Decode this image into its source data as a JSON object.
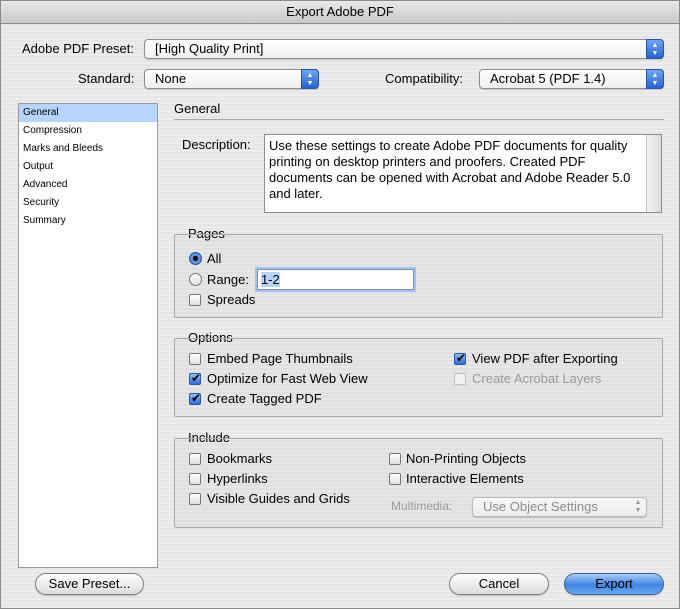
{
  "window": {
    "title": "Export Adobe PDF"
  },
  "header": {
    "preset_label": "Adobe PDF Preset:",
    "preset_value": "[High Quality Print]",
    "standard_label": "Standard:",
    "standard_value": "None",
    "compat_label": "Compatibility:",
    "compat_value": "Acrobat 5 (PDF 1.4)"
  },
  "sidebar": {
    "items": [
      "General",
      "Compression",
      "Marks and Bleeds",
      "Output",
      "Advanced",
      "Security",
      "Summary"
    ],
    "selected": "General"
  },
  "general": {
    "title": "General",
    "description_label": "Description:",
    "description_text": "Use these settings to create Adobe PDF documents for quality printing on desktop printers and proofers.  Created PDF documents can be opened with Acrobat and Adobe Reader 5.0 and later."
  },
  "pages": {
    "title": "Pages",
    "all_label": "All",
    "all_selected": true,
    "range_label": "Range:",
    "range_value": "1-2",
    "spreads_label": "Spreads",
    "spreads_checked": false
  },
  "options": {
    "title": "Options",
    "embed_thumbs": "Embed Page Thumbnails",
    "optimize_web": "Optimize for Fast Web View",
    "tagged_pdf": "Create Tagged PDF",
    "view_after": "View PDF after Exporting",
    "acrobat_layers": "Create Acrobat Layers"
  },
  "include": {
    "title": "Include",
    "bookmarks": "Bookmarks",
    "hyperlinks": "Hyperlinks",
    "guides_grids": "Visible Guides and Grids",
    "non_printing": "Non-Printing Objects",
    "interactive": "Interactive Elements",
    "multimedia_label": "Multimedia:",
    "multimedia_value": "Use Object Settings"
  },
  "footer": {
    "save_preset": "Save Preset...",
    "cancel": "Cancel",
    "export": "Export"
  },
  "colors": {
    "selection": "#b5d5ff",
    "accent": "#3f85e2"
  }
}
